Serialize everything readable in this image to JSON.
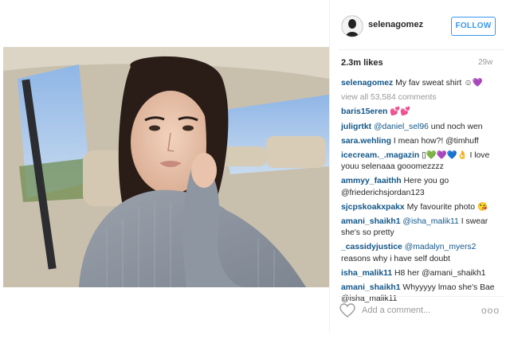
{
  "post": {
    "username": "selenagomez",
    "follow_label": "FOLLOW",
    "likes": "2.3m likes",
    "time_ago": "29w",
    "caption_user": "selenagomez",
    "caption_text": "My fav sweat shirt ☺💜",
    "view_all": "view all 53,584 comments",
    "add_comment_placeholder": "Add a comment...",
    "more_label": "ooo"
  },
  "comments": [
    {
      "user": "baris15eren",
      "mention": "",
      "text": "💕💕"
    },
    {
      "user": "juligrtkt",
      "mention": "@daniel_sel96",
      "text": "und noch wen"
    },
    {
      "user": "sara.wehling",
      "mention": "",
      "text": "I mean how?! @timhuff"
    },
    {
      "user": "icecream._.magazin",
      "mention": "",
      "text": "▯💚💜💙👌 I love youu selenaaa gooomezzzz"
    },
    {
      "user": "ammyy_faaithh",
      "mention": "",
      "text": "Here you go @friederichsjordan123"
    },
    {
      "user": "sjcpskoakxpakx",
      "mention": "",
      "text": "My favourite photo 😘"
    },
    {
      "user": "amani_shaikh1",
      "mention": "@isha_malik11",
      "text": "I swear she's so pretty"
    },
    {
      "user": "_cassidyjustice",
      "mention": "@madalyn_myers2",
      "text": "reasons why i have self doubt"
    },
    {
      "user": "isha_malik11",
      "mention": "",
      "text": "H8 her @amani_shaikh1"
    },
    {
      "user": "amani_shaikh1",
      "mention": "",
      "text": "Whyyyyy lmao she's Bae @isha_malik11"
    }
  ]
}
